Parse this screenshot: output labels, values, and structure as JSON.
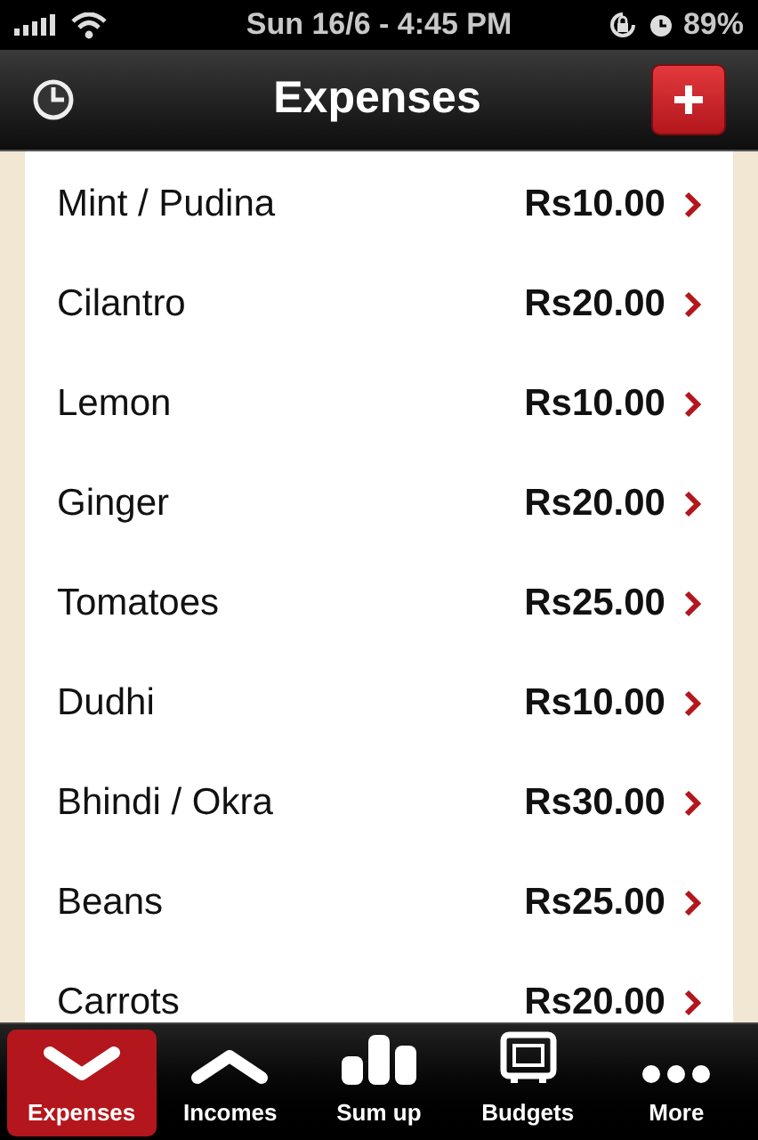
{
  "status_bar": {
    "time": "Sun 16/6 - 4:45 PM",
    "battery": "89%"
  },
  "header": {
    "title": "Expenses"
  },
  "expenses": [
    {
      "name": "Mint / Pudina",
      "amount": "Rs10.00"
    },
    {
      "name": "Cilantro",
      "amount": "Rs20.00"
    },
    {
      "name": "Lemon",
      "amount": "Rs10.00"
    },
    {
      "name": "Ginger",
      "amount": "Rs20.00"
    },
    {
      "name": "Tomatoes",
      "amount": "Rs25.00"
    },
    {
      "name": "Dudhi",
      "amount": "Rs10.00"
    },
    {
      "name": "Bhindi / Okra",
      "amount": "Rs30.00"
    },
    {
      "name": "Beans",
      "amount": "Rs25.00"
    },
    {
      "name": "Carrots",
      "amount": "Rs20.00"
    }
  ],
  "tab_bar": [
    {
      "label": "Expenses",
      "kind": "down",
      "selected": true
    },
    {
      "label": "Incomes",
      "kind": "up",
      "selected": false
    },
    {
      "label": "Sum up",
      "kind": "bars",
      "selected": false
    },
    {
      "label": "Budgets",
      "kind": "safe",
      "selected": false
    },
    {
      "label": "More",
      "kind": "dots",
      "selected": false
    }
  ]
}
